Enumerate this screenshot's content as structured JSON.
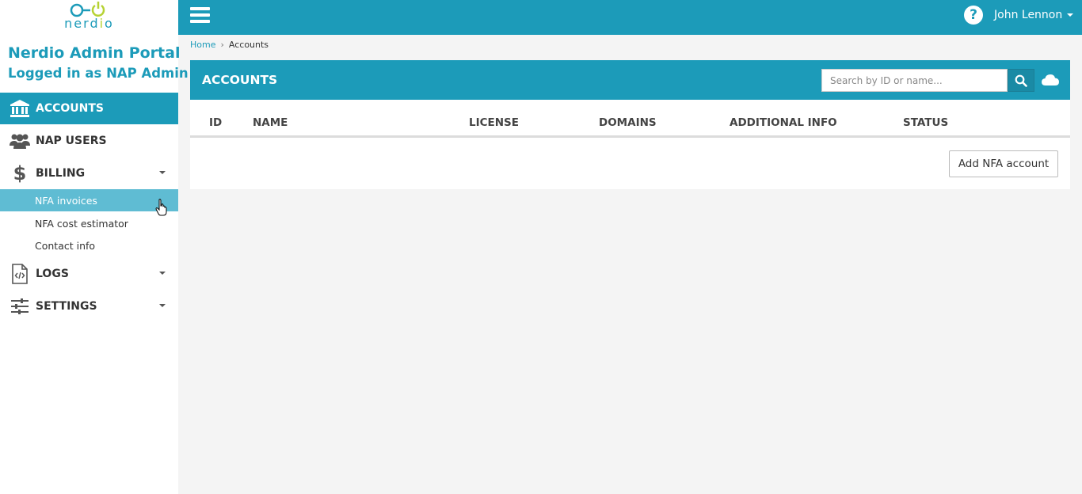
{
  "brand": {
    "logo_text_pre": "nerd",
    "logo_text_i": "i",
    "logo_text_post": "o",
    "portal_title": "Nerdio Admin Portal",
    "portal_subtitle": "Logged in as NAP Admin",
    "color": "#1c9bb9",
    "accent_color": "#b6d233"
  },
  "sidebar": {
    "items": [
      {
        "label": "ACCOUNTS",
        "icon": "bank-icon",
        "active": true
      },
      {
        "label": "NAP USERS",
        "icon": "users-icon"
      },
      {
        "label": "BILLING",
        "icon": "dollar-icon",
        "expanded": true,
        "children": [
          "NFA invoices",
          "NFA cost estimator",
          "Contact info"
        ]
      },
      {
        "label": "LOGS",
        "icon": "code-file-icon"
      },
      {
        "label": "SETTINGS",
        "icon": "sliders-icon"
      }
    ]
  },
  "topbar": {
    "user_name": "John Lennon",
    "help_glyph": "?"
  },
  "breadcrumb": {
    "home": "Home",
    "separator": "›",
    "current": "Accounts"
  },
  "panel": {
    "title": "ACCOUNTS",
    "search_placeholder": "Search by ID or name...",
    "search_value": "",
    "columns": [
      "ID",
      "NAME",
      "LICENSE",
      "DOMAINS",
      "ADDITIONAL INFO",
      "STATUS"
    ],
    "rows": [],
    "add_button": "Add NFA account"
  }
}
